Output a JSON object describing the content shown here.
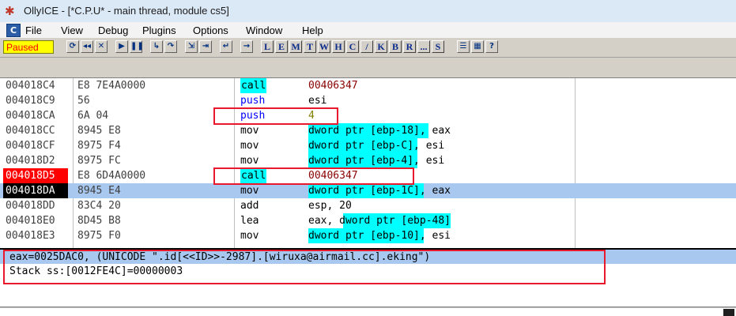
{
  "window": {
    "title": "OllyICE - [*C.P.U* - main thread, module cs5]"
  },
  "menu": [
    "File",
    "View",
    "Debug",
    "Plugins",
    "Options",
    "Window",
    "Help"
  ],
  "toolbar": {
    "status": "Paused",
    "letters": [
      "L",
      "E",
      "M",
      "T",
      "W",
      "H",
      "C",
      "/",
      "K",
      "B",
      "R",
      "...",
      "S"
    ]
  },
  "disasm": [
    {
      "addr": "004018C4",
      "hex": "E8 7E4A0000",
      "mnem": "call",
      "operand": "00406347"
    },
    {
      "addr": "004018C9",
      "hex": "56",
      "mnem": "push",
      "operand": "esi"
    },
    {
      "addr": "004018CA",
      "hex": "6A 04",
      "mnem": "push",
      "operand": "4"
    },
    {
      "addr": "004018CC",
      "hex": "8945 E8",
      "mnem": "mov",
      "operand": "dword ptr [ebp-18], eax"
    },
    {
      "addr": "004018CF",
      "hex": "8975 F4",
      "mnem": "mov",
      "operand": "dword ptr [ebp-C], esi"
    },
    {
      "addr": "004018D2",
      "hex": "8975 FC",
      "mnem": "mov",
      "operand": "dword ptr [ebp-4], esi"
    },
    {
      "addr": "004018D5",
      "hex": "E8 6D4A0000",
      "mnem": "call",
      "operand": "00406347"
    },
    {
      "addr": "004018DA",
      "hex": "8945 E4",
      "mnem": "mov",
      "operand": "dword ptr [ebp-1C], eax"
    },
    {
      "addr": "004018DD",
      "hex": "83C4 20",
      "mnem": "add",
      "operand": "esp, 20"
    },
    {
      "addr": "004018E0",
      "hex": "8D45 B8",
      "mnem": "lea",
      "operand": "eax, dword ptr [ebp-48]"
    },
    {
      "addr": "004018E3",
      "hex": "8975 F0",
      "mnem": "mov",
      "operand": "dword ptr [ebp-10], esi"
    }
  ],
  "info": {
    "line1": "eax=0025DAC0, (UNICODE \".id[<<ID>>-2987].[wiruxa@airmail.cc].eking\")",
    "line2": "Stack ss:[0012FE4C]=00000003"
  },
  "colors": {
    "highlight": "#00ffff",
    "annotation": "#e8192c",
    "breakpoint": "#ff0000",
    "selection": "#a8c8f0",
    "status_bg": "#ffff00"
  }
}
